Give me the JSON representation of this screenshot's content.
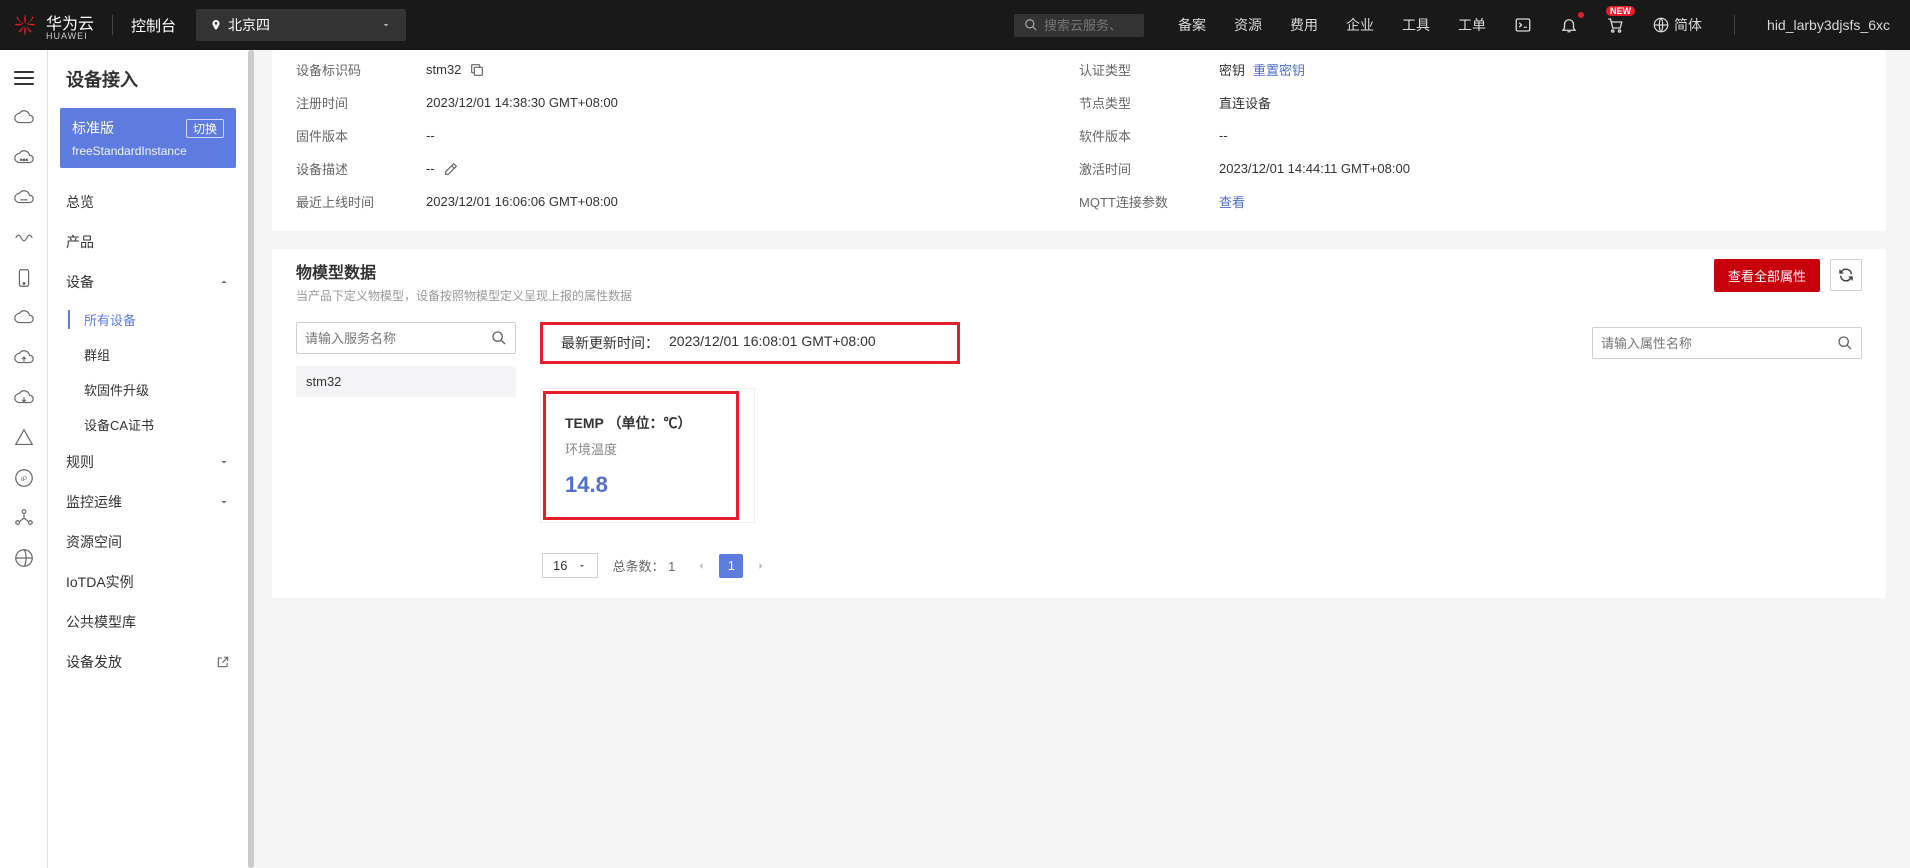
{
  "topbar": {
    "brand": "华为云",
    "brand_sub": "HUAWEI",
    "console": "控制台",
    "region": "北京四",
    "search_placeholder": "搜索云服务、",
    "nav": {
      "beian": "备案",
      "ziyuan": "资源",
      "feiyong": "费用",
      "qiye": "企业",
      "gongju": "工具",
      "gongdan": "工单",
      "lang": "简体",
      "new_badge": "NEW"
    },
    "user": "hid_larby3djsfs_6xc"
  },
  "sidebar": {
    "title": "设备接入",
    "card": {
      "title": "标准版",
      "switch": "切换",
      "sub": "freeStandardInstance"
    },
    "items": {
      "overview": "总览",
      "product": "产品",
      "device": "设备",
      "device_children": {
        "all": "所有设备",
        "group": "群组",
        "ota": "软固件升级",
        "ca": "设备CA证书"
      },
      "rule": "规则",
      "ops": "监控运维",
      "space": "资源空间",
      "iotda": "IoTDA实例",
      "modellib": "公共模型库",
      "provision": "设备发放"
    }
  },
  "detail": {
    "left": {
      "id_label": "设备标识码",
      "id_value": "stm32",
      "reg_label": "注册时间",
      "reg_value": "2023/12/01 14:38:30 GMT+08:00",
      "fw_label": "固件版本",
      "fw_value": "--",
      "desc_label": "设备描述",
      "desc_value": "--",
      "last_label": "最近上线时间",
      "last_value": "2023/12/01 16:06:06 GMT+08:00"
    },
    "right": {
      "auth_label": "认证类型",
      "auth_value": "密钥",
      "auth_action": "重置密钥",
      "node_label": "节点类型",
      "node_value": "直连设备",
      "sw_label": "软件版本",
      "sw_value": "--",
      "act_label": "激活时间",
      "act_value": "2023/12/01 14:44:11 GMT+08:00",
      "mqtt_label": "MQTT连接参数",
      "mqtt_action": "查看"
    }
  },
  "model": {
    "title": "物模型数据",
    "desc": "当产品下定义物模型，设备按照物模型定义呈现上报的属性数据",
    "view_all": "查看全部属性",
    "svc_search_placeholder": "请输入服务名称",
    "svc_item": "stm32",
    "update_label": "最新更新时间：",
    "update_value": "2023/12/01 16:08:01 GMT+08:00",
    "attr_search_placeholder": "请输入属性名称",
    "property": {
      "name": "TEMP （单位：℃）",
      "desc": "环境温度",
      "value": "14.8"
    },
    "pager": {
      "size": "16",
      "total_label": "总条数：",
      "total": "1",
      "page": "1"
    }
  }
}
